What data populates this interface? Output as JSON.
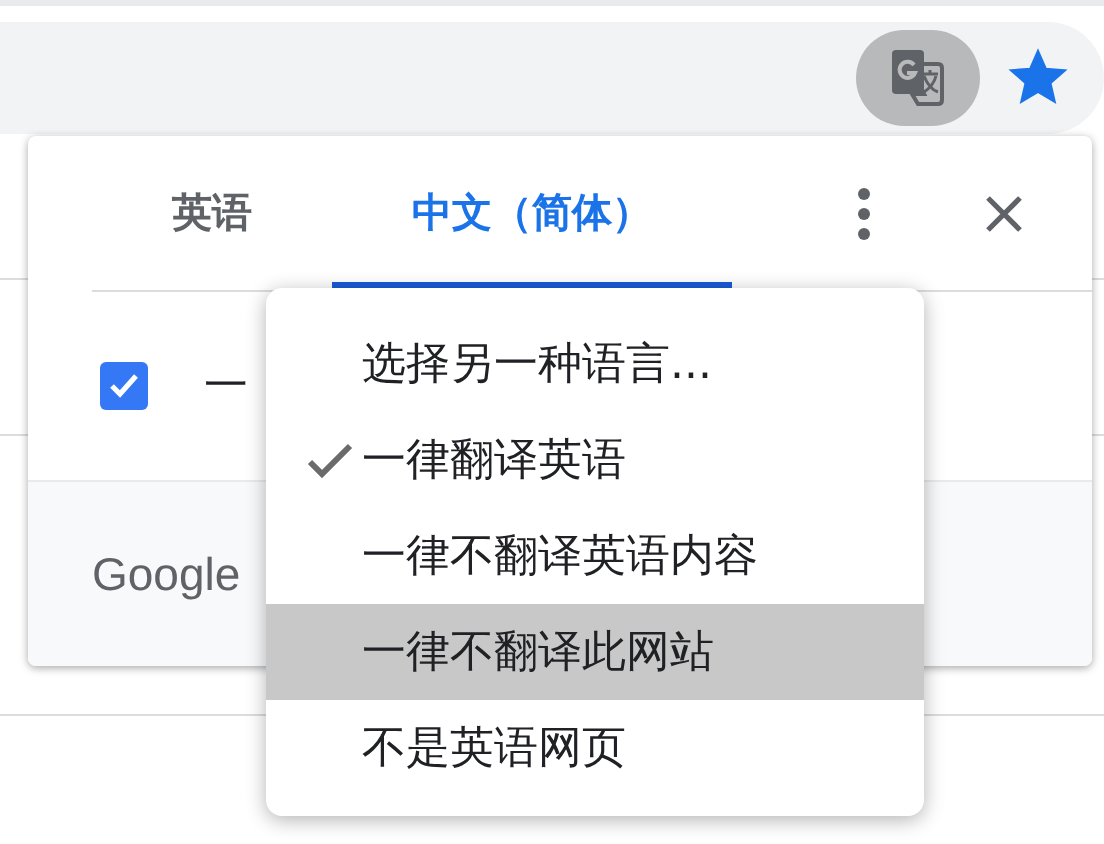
{
  "toolbar": {
    "translate_active": true,
    "bookmarked": true
  },
  "popup": {
    "tabs": [
      {
        "label": "英语",
        "selected": false
      },
      {
        "label": "中文（简体）",
        "selected": true
      }
    ],
    "option": {
      "label": "一",
      "checked": true
    },
    "footer": "Google"
  },
  "menu": {
    "items": [
      {
        "label": "选择另一种语言...",
        "checked": false,
        "selected": false
      },
      {
        "label": "一律翻译英语",
        "checked": true,
        "selected": false
      },
      {
        "label": "一律不翻译英语内容",
        "checked": false,
        "selected": false
      },
      {
        "label": "一律不翻译此网站",
        "checked": false,
        "selected": true
      },
      {
        "label": "不是英语网页",
        "checked": false,
        "selected": false
      }
    ]
  }
}
